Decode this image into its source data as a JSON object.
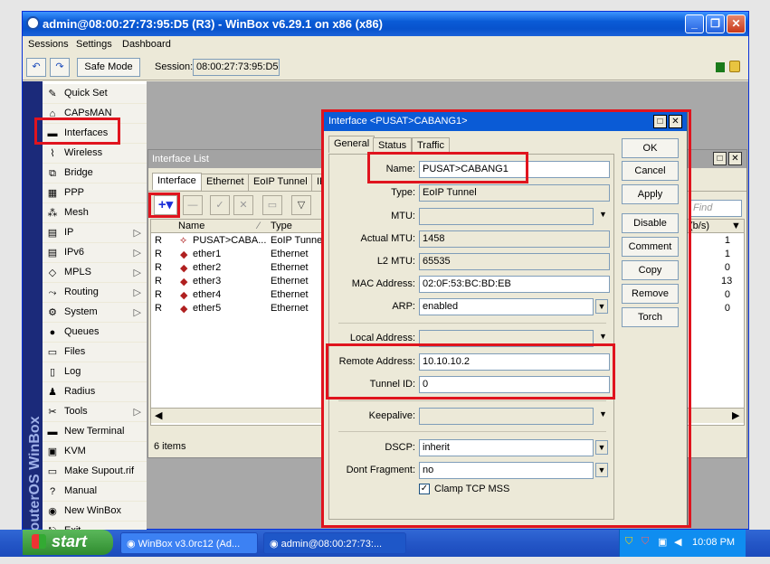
{
  "window": {
    "title": "admin@08:00:27:73:95:D5 (R3) - WinBox v6.29.1 on x86 (x86)"
  },
  "menubar": [
    "Sessions",
    "Settings",
    "Dashboard"
  ],
  "toolbar": {
    "safe_mode": "Safe Mode",
    "session_label": "Session:",
    "session_value": "08:00:27:73:95:D5"
  },
  "sidebar": {
    "brand": "RouterOS WinBox",
    "items": [
      {
        "label": "Quick Set",
        "icon": "quickset-icon"
      },
      {
        "label": "CAPsMAN",
        "icon": "capsman-icon"
      },
      {
        "label": "Interfaces",
        "icon": "interfaces-icon"
      },
      {
        "label": "Wireless",
        "icon": "wireless-icon"
      },
      {
        "label": "Bridge",
        "icon": "bridge-icon"
      },
      {
        "label": "PPP",
        "icon": "ppp-icon"
      },
      {
        "label": "Mesh",
        "icon": "mesh-icon"
      },
      {
        "label": "IP",
        "icon": "ip-icon"
      },
      {
        "label": "IPv6",
        "icon": "ipv6-icon"
      },
      {
        "label": "MPLS",
        "icon": "mpls-icon"
      },
      {
        "label": "Routing",
        "icon": "routing-icon"
      },
      {
        "label": "System",
        "icon": "system-icon"
      },
      {
        "label": "Queues",
        "icon": "queues-icon"
      },
      {
        "label": "Files",
        "icon": "files-icon"
      },
      {
        "label": "Log",
        "icon": "log-icon"
      },
      {
        "label": "Radius",
        "icon": "radius-icon"
      },
      {
        "label": "Tools",
        "icon": "tools-icon"
      },
      {
        "label": "New Terminal",
        "icon": "terminal-icon"
      },
      {
        "label": "KVM",
        "icon": "kvm-icon"
      },
      {
        "label": "Make Supout.rif",
        "icon": "supout-icon"
      },
      {
        "label": "Manual",
        "icon": "manual-icon"
      },
      {
        "label": "New WinBox",
        "icon": "winbox-icon"
      },
      {
        "label": "Exit",
        "icon": "exit-icon"
      }
    ]
  },
  "iflist": {
    "title": "Interface List",
    "tabs": [
      "Interface",
      "Ethernet",
      "EoIP Tunnel",
      "IP"
    ],
    "find_placeholder": "Find",
    "columns": [
      "Name",
      "Type"
    ],
    "right_column": "(b/s)",
    "rows": [
      {
        "flag": "R",
        "name": "PUSAT>CABA...",
        "type": "EoIP Tunne",
        "val": "1"
      },
      {
        "flag": "R",
        "name": "ether1",
        "type": "Ethernet",
        "val": "1"
      },
      {
        "flag": "R",
        "name": "ether2",
        "type": "Ethernet",
        "val": "0"
      },
      {
        "flag": "R",
        "name": "ether3",
        "type": "Ethernet",
        "val": "13"
      },
      {
        "flag": "R",
        "name": "ether4",
        "type": "Ethernet",
        "val": "0"
      },
      {
        "flag": "R",
        "name": "ether5",
        "type": "Ethernet",
        "val": "0"
      }
    ],
    "status": "6 items"
  },
  "dialog": {
    "title": "Interface <PUSAT>CABANG1>",
    "tabs": [
      "General",
      "Status",
      "Traffic"
    ],
    "fields": {
      "name": {
        "label": "Name:",
        "value": "PUSAT>CABANG1"
      },
      "type": {
        "label": "Type:",
        "value": "EoIP Tunnel"
      },
      "mtu": {
        "label": "MTU:",
        "value": ""
      },
      "actual_mtu": {
        "label": "Actual MTU:",
        "value": "1458"
      },
      "l2_mtu": {
        "label": "L2 MTU:",
        "value": "65535"
      },
      "mac": {
        "label": "MAC Address:",
        "value": "02:0F:53:BC:BD:EB"
      },
      "arp": {
        "label": "ARP:",
        "value": "enabled"
      },
      "local_address": {
        "label": "Local Address:",
        "value": ""
      },
      "remote_address": {
        "label": "Remote Address:",
        "value": "10.10.10.2"
      },
      "tunnel_id": {
        "label": "Tunnel ID:",
        "value": "0"
      },
      "keepalive": {
        "label": "Keepalive:",
        "value": ""
      },
      "dscp": {
        "label": "DSCP:",
        "value": "inherit"
      },
      "dont_fragment": {
        "label": "Dont Fragment:",
        "value": "no"
      },
      "clamp": {
        "label": "Clamp TCP MSS"
      }
    },
    "buttons": [
      "OK",
      "Cancel",
      "Apply",
      "Disable",
      "Comment",
      "Copy",
      "Remove",
      "Torch"
    ]
  },
  "taskbar": {
    "start": "start",
    "tasks": [
      "WinBox v3.0rc12 (Ad...",
      "admin@08:00:27:73:..."
    ],
    "clock": "10:08 PM"
  },
  "colors": {
    "highlight": "#e0141e",
    "title_blue": "#0a5bd6"
  }
}
